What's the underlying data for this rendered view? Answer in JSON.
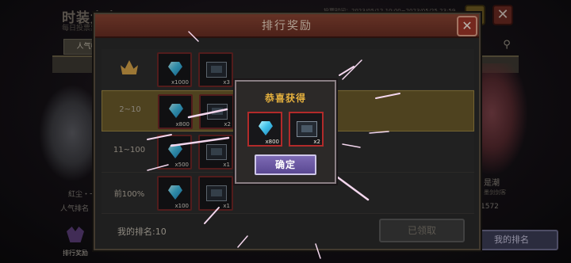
{
  "background": {
    "event_title": "时装大赛",
    "event_subtitle": "每日投票票",
    "vote_period": "投票时间：2023/05/12 10:00~2023/05/25 23:59",
    "tab_popularity": "人气榜",
    "left_entry_name": "紅尘・一",
    "left_entry_votes": "人气排名",
    "right_entry_name": "是潮",
    "right_entry_author": "墨剑剑客",
    "right_entry_count": "1572",
    "my_rank_button": "我的排名",
    "reward_tab_label": "排行奖励",
    "close_label": "✕"
  },
  "rank_panel": {
    "title": "排行奖励",
    "close_label": "✕",
    "rows": [
      {
        "rank": "",
        "is_top": true,
        "highlighted": false,
        "gem_qty": "x1000",
        "costume_qty": "x3"
      },
      {
        "rank": "2~10",
        "is_top": false,
        "highlighted": true,
        "gem_qty": "x800",
        "costume_qty": "x2"
      },
      {
        "rank": "11~100",
        "is_top": false,
        "highlighted": false,
        "gem_qty": "x500",
        "costume_qty": "x1"
      },
      {
        "rank": "前100%",
        "is_top": false,
        "highlighted": false,
        "gem_qty": "x100",
        "costume_qty": "x1"
      }
    ],
    "my_rank": "我的排名:10",
    "claimed_label": "已领取"
  },
  "obtain_popup": {
    "title": "恭喜获得",
    "items": [
      {
        "icon": "diamond-icon",
        "qty": "x800"
      },
      {
        "icon": "costume-icon",
        "qty": "x2"
      }
    ],
    "confirm_label": "确定"
  },
  "colors": {
    "accent_gold": "#e6b13e",
    "highlight_row": "#6c5c2c",
    "slot_border": "#722828",
    "confirm_button": "#6b58a4"
  }
}
